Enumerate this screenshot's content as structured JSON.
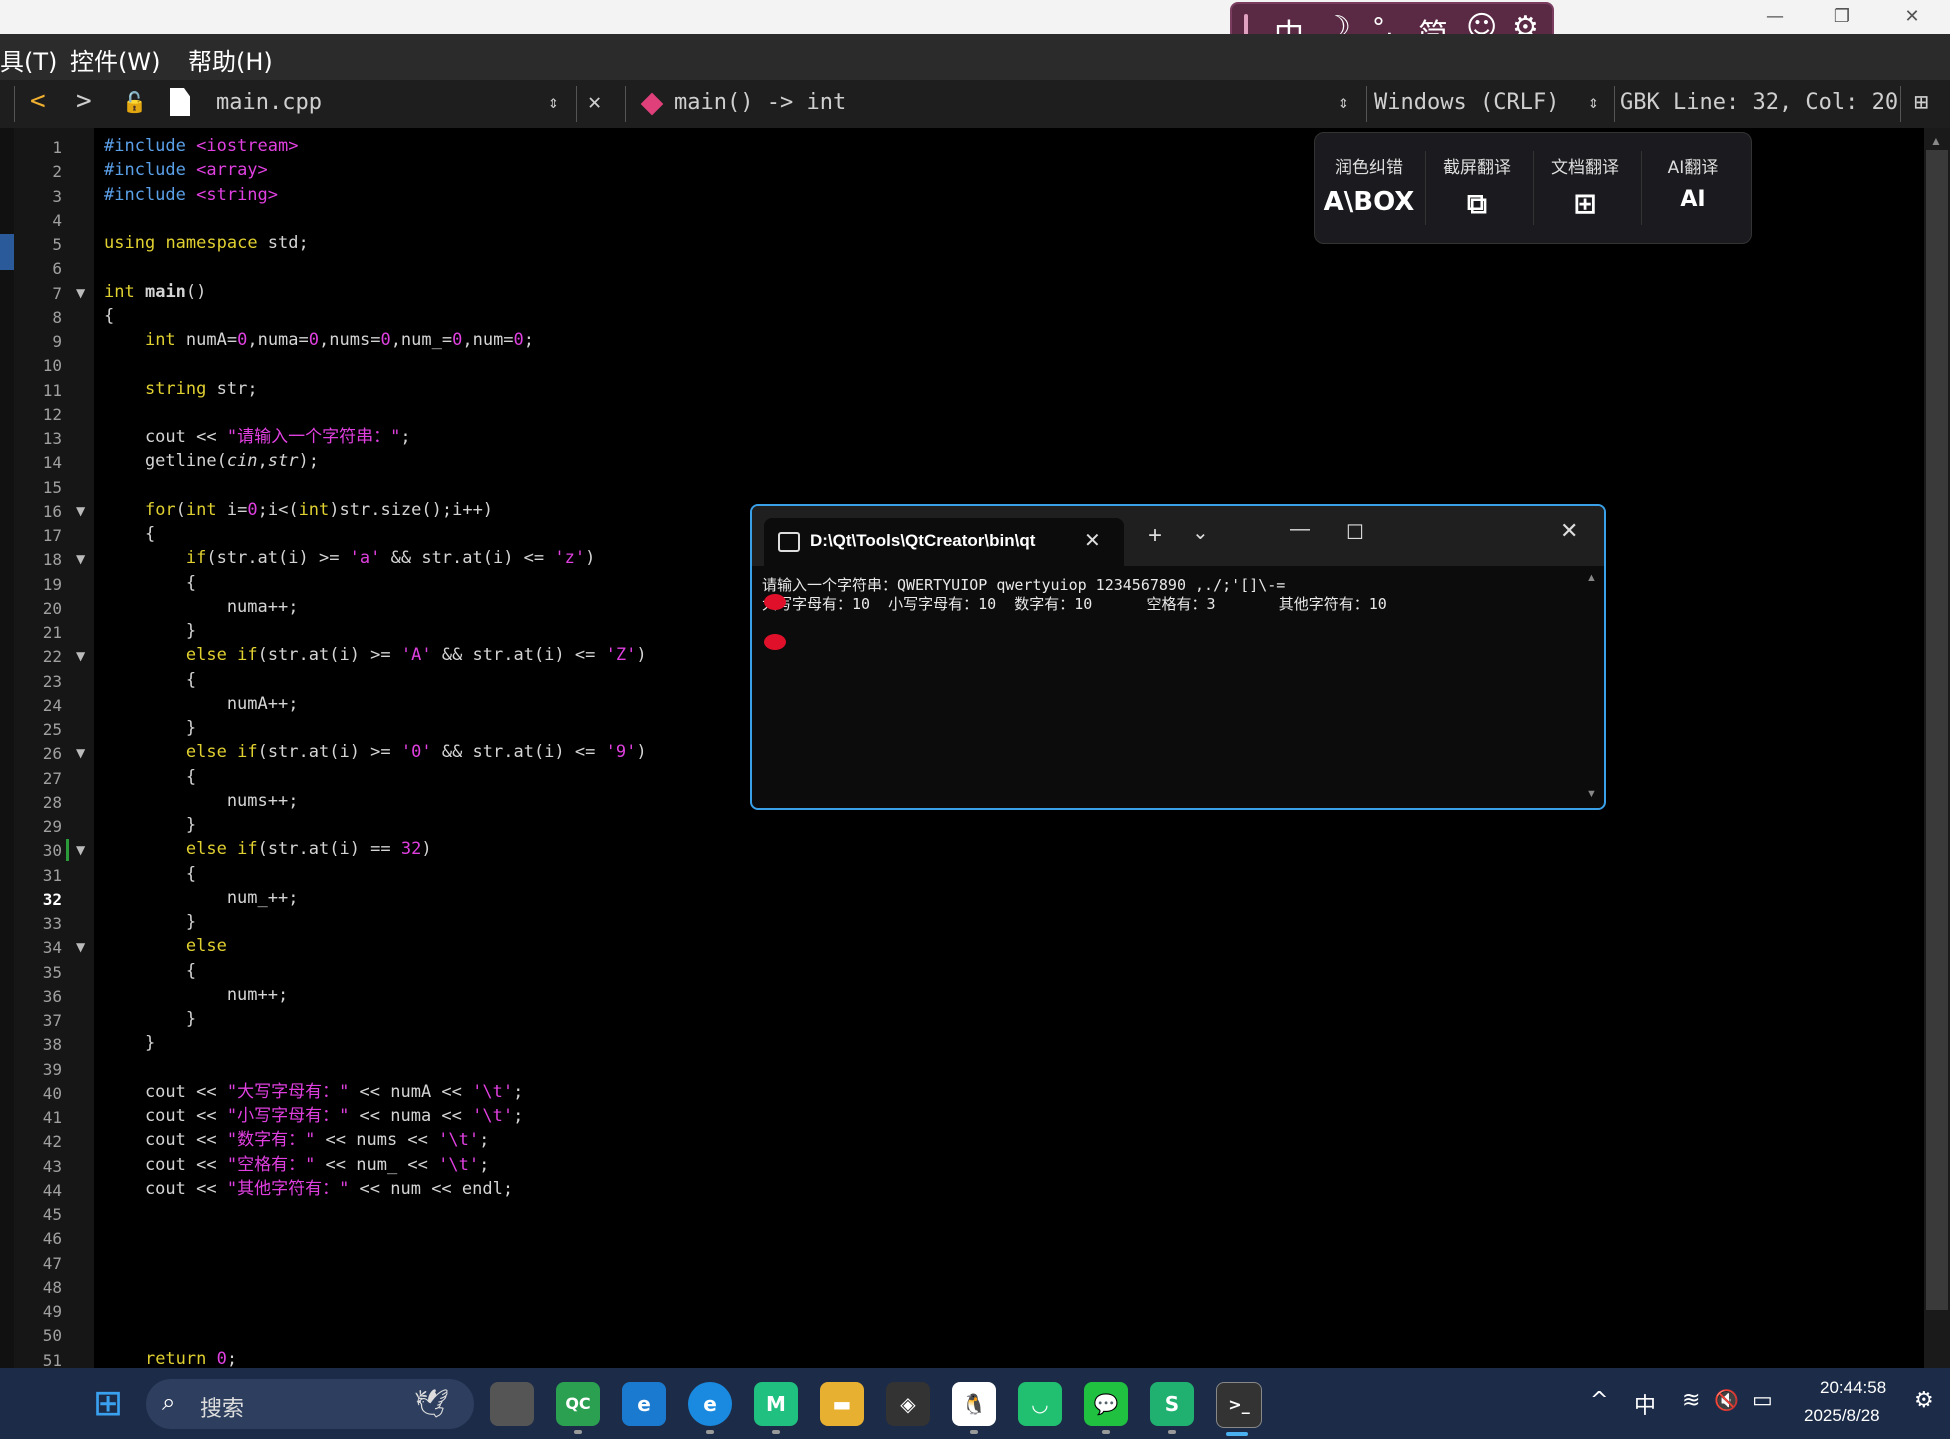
{
  "window": {
    "minimize_glyph": "—",
    "maximize_glyph": "❐",
    "close_glyph": "✕"
  },
  "menubar": {
    "items": [
      "具(T)",
      "控件(W)",
      "帮助(H)"
    ]
  },
  "ime": {
    "items": [
      "中",
      "☽",
      "°,",
      "简",
      "☺",
      "⚙"
    ]
  },
  "toolbar": {
    "back": "<",
    "forward": ">",
    "lock": "🔓",
    "file": "main.cpp",
    "close": "✕",
    "symbol": "main() -> int",
    "line_ending": "Windows (CRLF)",
    "status": "GBK Line: 32, Col: 20",
    "split": "⊞"
  },
  "tool_panel": {
    "items": [
      {
        "label": "润色纠错",
        "icon": "A\\BOX"
      },
      {
        "label": "截屏翻译",
        "icon": "⧉"
      },
      {
        "label": "文档翻译",
        "icon": "⊞"
      },
      {
        "label": "AI翻译",
        "icon": "AI"
      }
    ]
  },
  "editor": {
    "current_line": 32,
    "folds": [
      7,
      16,
      18,
      22,
      26,
      30,
      34
    ],
    "lines": [
      "#include <iostream>",
      "#include <array>",
      "#include <string>",
      "",
      "using namespace std;",
      "",
      "int main()",
      "{",
      "    int numA=0,numa=0,nums=0,num_=0,num=0;",
      "",
      "    string str;",
      "",
      "    cout << \"请输入一个字符串：\";",
      "    getline(cin,str);",
      "",
      "    for(int i=0;i<(int)str.size();i++)",
      "    {",
      "        if(str.at(i) >= 'a' && str.at(i) <= 'z')",
      "        {",
      "            numa++;",
      "        }",
      "        else if(str.at(i) >= 'A' && str.at(i) <= 'Z')",
      "        {",
      "            numA++;",
      "        }",
      "        else if(str.at(i) >= '0' && str.at(i) <= '9')",
      "        {",
      "            nums++;",
      "        }",
      "        else if(str.at(i) == 32)",
      "        {",
      "            num_++;",
      "        }",
      "        else",
      "        {",
      "            num++;",
      "        }",
      "    }",
      "",
      "    cout << \"大写字母有：\" << numA << '\\t';",
      "    cout << \"小写字母有：\" << numa << '\\t';",
      "    cout << \"数字有：\" << nums << '\\t';",
      "    cout << \"空格有：\" << num_ << '\\t';",
      "    cout << \"其他字符有：\" << num << endl;",
      "",
      "",
      "",
      "",
      "",
      "",
      "    return 0;"
    ]
  },
  "terminal": {
    "title": "D:\\Qt\\Tools\\QtCreator\\bin\\qt",
    "new_tab": "+",
    "dropdown": "⌄",
    "output": "请输入一个字符串：QWERTYUIOP qwertyuiop 1234567890 ,./;'[]\\-=\n大写字母有：10  小写字母有：10  数字有：10      空格有：3       其他字符有：10"
  },
  "taskbar": {
    "search_placeholder": "搜索",
    "apps": [
      "⊞",
      "QC",
      "e",
      "e",
      "M",
      "▬",
      "◈",
      "🐧",
      "◡",
      "💬",
      "S",
      ">_"
    ],
    "tray": {
      "chevron": "^",
      "ime": "中",
      "wifi": "≋",
      "volume": "🔇",
      "battery": "▭"
    },
    "time": "20:44:58",
    "date": "2025/8/28"
  }
}
